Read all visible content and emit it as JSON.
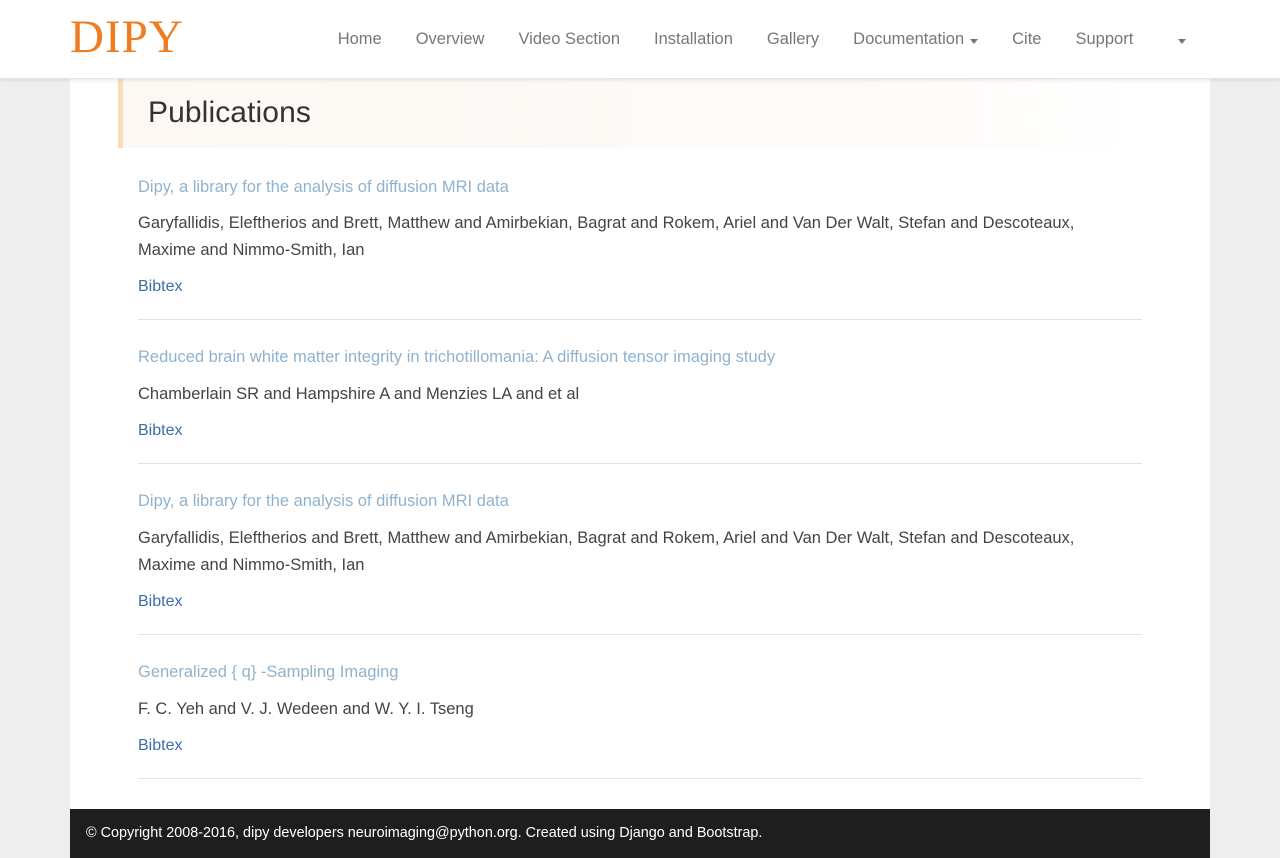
{
  "navbar": {
    "brand": "DIPY",
    "items": [
      {
        "label": "Home",
        "has_caret": false
      },
      {
        "label": "Overview",
        "has_caret": false
      },
      {
        "label": "Video Section",
        "has_caret": false
      },
      {
        "label": "Installation",
        "has_caret": false
      },
      {
        "label": "Gallery",
        "has_caret": false
      },
      {
        "label": "Documentation",
        "has_caret": true
      },
      {
        "label": "Cite",
        "has_caret": false
      },
      {
        "label": "Support",
        "has_caret": false
      }
    ],
    "trailing_caret": true
  },
  "page": {
    "heading": "Publications",
    "bibtex_label": "Bibtex"
  },
  "publications": [
    {
      "title": "Dipy, a library for the analysis of diffusion MRI data",
      "authors": "Garyfallidis, Eleftherios and Brett, Matthew and Amirbekian, Bagrat and Rokem, Ariel and Van Der Walt, Stefan and Descoteaux, Maxime and Nimmo-Smith, Ian",
      "bibtex": "Bibtex"
    },
    {
      "title": "Reduced brain white matter integrity in trichotillomania: A diffusion tensor imaging study",
      "authors": "Chamberlain SR and Hampshire A and Menzies LA and et al",
      "bibtex": "Bibtex"
    },
    {
      "title": "Dipy, a library for the analysis of diffusion MRI data",
      "authors": "Garyfallidis, Eleftherios and Brett, Matthew and Amirbekian, Bagrat and Rokem, Ariel and Van Der Walt, Stefan and Descoteaux, Maxime and Nimmo-Smith, Ian",
      "bibtex": "Bibtex"
    },
    {
      "title": "Generalized { q} -Sampling Imaging",
      "authors": "F. C. Yeh and V. J. Wedeen and W. Y. I. Tseng",
      "bibtex": "Bibtex"
    }
  ],
  "footer": {
    "text": "© Copyright 2008-2016, dipy developers neuroimaging@python.org. Created using Django and Bootstrap."
  },
  "colors": {
    "brand_orange": "#ef7c1f",
    "heading_accent": "#fadcb9",
    "title_link": "#8fb3cf",
    "bibtex_link": "#3b6ea8",
    "nav_text": "#777777",
    "footer_bg": "#1e1e1e",
    "page_bg": "#eeeeee"
  }
}
